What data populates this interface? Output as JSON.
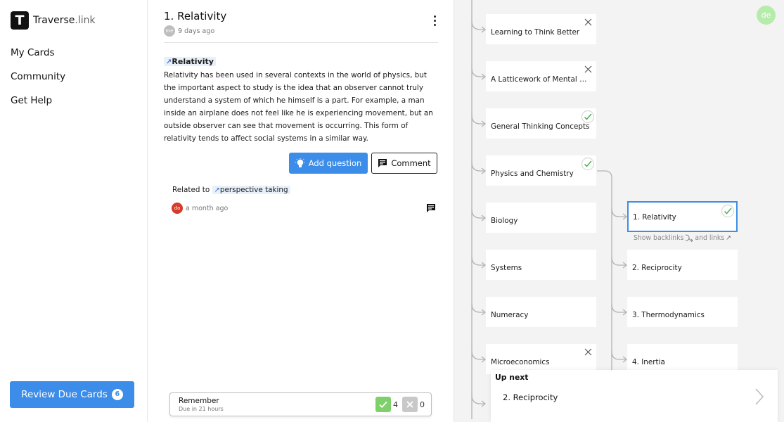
{
  "app": {
    "logo_letter": "T",
    "name_bold": "Traverse",
    "name_light": ".link"
  },
  "sidebar": {
    "items": [
      {
        "label": "My Cards"
      },
      {
        "label": "Community"
      },
      {
        "label": "Get Help"
      }
    ],
    "review_button": {
      "label": "Review Due Cards",
      "count": "6"
    }
  },
  "card": {
    "title": "1. Relativity",
    "author_initials": "me",
    "time": "9 days ago",
    "heading_link": "Relativity",
    "body": "Relativity has been used in several contexts in the world of physics, but the important aspect to study is the idea that an observer cannot truly understand a system of which he himself is a part. For example, a man inside an airplane does not feel like he is experiencing movement, but an outside observer can see that movement is occurring. This form of relativity tends to affect social systems in a similar way.",
    "add_question_label": "Add question",
    "comment_label": "Comment",
    "related": {
      "prefix": "Related to",
      "link": "perspective taking",
      "author_initials": "do",
      "time": "a month ago"
    }
  },
  "review_bar": {
    "label": "Remember",
    "sub": "Due in 21 hours",
    "yes_count": "4",
    "no_count": "0"
  },
  "graph": {
    "left_nodes": [
      {
        "label": "Learning to Think Better",
        "status": "x"
      },
      {
        "label": "A Latticework of Mental Mo...",
        "status": "x"
      },
      {
        "label": "General Thinking Concepts",
        "status": "check"
      },
      {
        "label": "Physics and Chemistry",
        "status": "check"
      },
      {
        "label": "Biology",
        "status": ""
      },
      {
        "label": "Systems",
        "status": ""
      },
      {
        "label": "Numeracy",
        "status": ""
      },
      {
        "label": "Microeconomics",
        "status": "x"
      }
    ],
    "right_nodes": [
      {
        "label": "1. Relativity",
        "status": "check",
        "selected": true
      },
      {
        "label": "2. Reciprocity",
        "status": ""
      },
      {
        "label": "3. Thermodynamics",
        "status": ""
      },
      {
        "label": "4. Inertia",
        "status": ""
      }
    ],
    "backlinks_label": "Show backlinks",
    "links_label": "and links",
    "user_initials": "de"
  },
  "upnext": {
    "label": "Up next",
    "title": "2. Reciprocity"
  },
  "colors": {
    "accent": "#3b8de9",
    "success": "#7ed06b",
    "selected_border": "#3d8fe4",
    "avatar_do": "#d63a2a",
    "avatar_de": "#b6ecab"
  }
}
